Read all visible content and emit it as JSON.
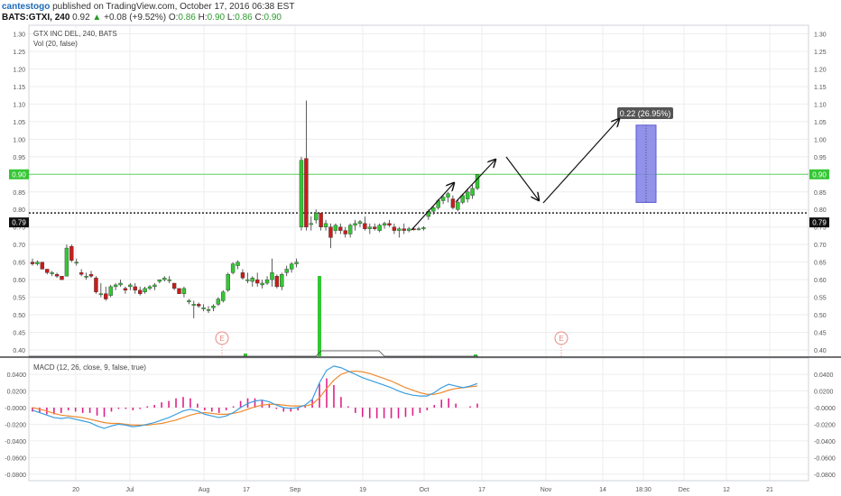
{
  "header": {
    "author": "cantestogo",
    "published_text": "published on TradingView.com, October 17, 2016 06:38 EST",
    "symbol": "BATS:GTXI, 240",
    "last": "0.92",
    "change_arrow": "▲",
    "change": "+0.08 (+9.52%)",
    "o_label": "O:",
    "o_value": "0.86",
    "h_label": "H:",
    "h_value": "0.90",
    "l_label": "L:",
    "l_value": "0.86",
    "c_label": "C:",
    "c_value": "0.90"
  },
  "colors": {
    "up": "#34c734",
    "down": "#c91c1c",
    "grid": "#eeeeee",
    "macd_line": "#3a9ee0",
    "signal_line": "#f08a2e",
    "histogram": "#e0218a",
    "green_level": "#5fd35f",
    "target_box": "#7f7fe8"
  },
  "chart_data": [
    {
      "type": "candlestick",
      "title": "GTX INC DEL, 240, BATS",
      "subtitle": "Vol (20, false)",
      "ylim": [
        0.36,
        1.32
      ],
      "y_ticks": [
        "1.30",
        "1.25",
        "1.20",
        "1.15",
        "1.10",
        "1.05",
        "1.00",
        "0.95",
        "0.90",
        "0.85",
        "0.80",
        "0.75",
        "0.70",
        "0.65",
        "0.60",
        "0.55",
        "0.50",
        "0.45",
        "0.40"
      ],
      "x_ticks": [
        "20",
        "Jul",
        "Aug",
        "17",
        "Sep",
        "19",
        "Oct",
        "17",
        "Nov",
        "14",
        "18:30",
        "Dec",
        "12",
        "21"
      ],
      "current_price_label": "0.90",
      "dotted_level_label": "0.79",
      "green_level": 0.9,
      "dotted_level": 0.79,
      "earnings_marker": "E",
      "annotation": "0.22 (26.95%)",
      "target_from": 0.82,
      "target_to": 1.04,
      "candles": [
        [
          0.65,
          0.66,
          0.64,
          0.645
        ],
        [
          0.645,
          0.655,
          0.64,
          0.65
        ],
        [
          0.65,
          0.65,
          0.63,
          0.63
        ],
        [
          0.63,
          0.63,
          0.615,
          0.62
        ],
        [
          0.62,
          0.625,
          0.61,
          0.62
        ],
        [
          0.615,
          0.62,
          0.605,
          0.61
        ],
        [
          0.61,
          0.61,
          0.6,
          0.6
        ],
        [
          0.61,
          0.7,
          0.61,
          0.69
        ],
        [
          0.695,
          0.7,
          0.65,
          0.655
        ],
        [
          0.65,
          0.66,
          0.64,
          0.65
        ],
        [
          0.62,
          0.63,
          0.61,
          0.615
        ],
        [
          0.61,
          0.62,
          0.6,
          0.61
        ],
        [
          0.615,
          0.625,
          0.605,
          0.61
        ],
        [
          0.605,
          0.61,
          0.56,
          0.565
        ],
        [
          0.56,
          0.59,
          0.55,
          0.56
        ],
        [
          0.56,
          0.58,
          0.54,
          0.545
        ],
        [
          0.555,
          0.585,
          0.55,
          0.58
        ],
        [
          0.58,
          0.59,
          0.57,
          0.585
        ],
        [
          0.585,
          0.6,
          0.58,
          0.59
        ],
        [
          0.575,
          0.58,
          0.56,
          0.57
        ],
        [
          0.58,
          0.59,
          0.57,
          0.585
        ],
        [
          0.58,
          0.59,
          0.56,
          0.57
        ],
        [
          0.57,
          0.58,
          0.555,
          0.56
        ],
        [
          0.565,
          0.58,
          0.56,
          0.575
        ],
        [
          0.575,
          0.585,
          0.57,
          0.58
        ],
        [
          0.58,
          0.59,
          0.57,
          0.585
        ],
        [
          0.595,
          0.6,
          0.59,
          0.6
        ],
        [
          0.6,
          0.61,
          0.595,
          0.605
        ],
        [
          0.6,
          0.61,
          0.59,
          0.6
        ],
        [
          0.59,
          0.59,
          0.57,
          0.575
        ],
        [
          0.575,
          0.575,
          0.56,
          0.56
        ],
        [
          0.56,
          0.58,
          0.55,
          0.575
        ],
        [
          0.54,
          0.545,
          0.53,
          0.54
        ],
        [
          0.53,
          0.54,
          0.49,
          0.53
        ],
        [
          0.53,
          0.535,
          0.52,
          0.525
        ],
        [
          0.52,
          0.53,
          0.51,
          0.52
        ],
        [
          0.515,
          0.525,
          0.505,
          0.515
        ],
        [
          0.52,
          0.53,
          0.51,
          0.525
        ],
        [
          0.53,
          0.55,
          0.525,
          0.545
        ],
        [
          0.54,
          0.57,
          0.535,
          0.565
        ],
        [
          0.57,
          0.62,
          0.565,
          0.615
        ],
        [
          0.62,
          0.65,
          0.615,
          0.645
        ],
        [
          0.64,
          0.655,
          0.63,
          0.65
        ],
        [
          0.62,
          0.63,
          0.6,
          0.605
        ],
        [
          0.6,
          0.62,
          0.59,
          0.6
        ],
        [
          0.595,
          0.61,
          0.58,
          0.605
        ],
        [
          0.6,
          0.62,
          0.58,
          0.59
        ],
        [
          0.585,
          0.6,
          0.575,
          0.59
        ],
        [
          0.59,
          0.61,
          0.585,
          0.6
        ],
        [
          0.6,
          0.66,
          0.58,
          0.62
        ],
        [
          0.61,
          0.615,
          0.575,
          0.58
        ],
        [
          0.58,
          0.62,
          0.57,
          0.615
        ],
        [
          0.62,
          0.64,
          0.61,
          0.63
        ],
        [
          0.63,
          0.65,
          0.62,
          0.645
        ],
        [
          0.645,
          0.66,
          0.635,
          0.65
        ],
        [
          0.75,
          0.95,
          0.74,
          0.94
        ],
        [
          0.945,
          1.11,
          0.74,
          0.75
        ],
        [
          0.76,
          0.78,
          0.74,
          0.76
        ],
        [
          0.77,
          0.8,
          0.76,
          0.79
        ],
        [
          0.79,
          0.79,
          0.74,
          0.75
        ],
        [
          0.75,
          0.77,
          0.74,
          0.76
        ],
        [
          0.75,
          0.76,
          0.69,
          0.72
        ],
        [
          0.74,
          0.76,
          0.73,
          0.755
        ],
        [
          0.75,
          0.76,
          0.73,
          0.74
        ],
        [
          0.74,
          0.75,
          0.72,
          0.73
        ],
        [
          0.73,
          0.76,
          0.72,
          0.755
        ],
        [
          0.755,
          0.77,
          0.74,
          0.76
        ],
        [
          0.76,
          0.77,
          0.75,
          0.765
        ],
        [
          0.76,
          0.78,
          0.74,
          0.745
        ],
        [
          0.745,
          0.76,
          0.73,
          0.75
        ],
        [
          0.75,
          0.76,
          0.74,
          0.745
        ],
        [
          0.74,
          0.76,
          0.735,
          0.755
        ],
        [
          0.755,
          0.765,
          0.745,
          0.76
        ],
        [
          0.76,
          0.77,
          0.75,
          0.755
        ],
        [
          0.75,
          0.76,
          0.73,
          0.74
        ],
        [
          0.74,
          0.75,
          0.72,
          0.745
        ],
        [
          0.745,
          0.76,
          0.73,
          0.74
        ],
        [
          0.74,
          0.75,
          0.735,
          0.745
        ],
        [
          0.745,
          0.75,
          0.74,
          0.742
        ],
        [
          0.742,
          0.75,
          0.74,
          0.745
        ],
        [
          0.745,
          0.752,
          0.74,
          0.748
        ],
        [
          0.78,
          0.8,
          0.77,
          0.795
        ],
        [
          0.795,
          0.81,
          0.785,
          0.805
        ],
        [
          0.805,
          0.83,
          0.8,
          0.825
        ],
        [
          0.825,
          0.84,
          0.815,
          0.835
        ],
        [
          0.835,
          0.85,
          0.82,
          0.845
        ],
        [
          0.83,
          0.84,
          0.8,
          0.805
        ],
        [
          0.8,
          0.83,
          0.795,
          0.82
        ],
        [
          0.82,
          0.845,
          0.815,
          0.84
        ],
        [
          0.83,
          0.86,
          0.82,
          0.85
        ],
        [
          0.84,
          0.87,
          0.83,
          0.86
        ],
        [
          0.86,
          0.9,
          0.855,
          0.9
        ]
      ]
    },
    {
      "type": "line",
      "title": "MACD (12, 26, close, 9, false, true)",
      "ylim": [
        -0.09,
        0.06
      ],
      "y_ticks": [
        "0.0400",
        "0.0200",
        "-0.0000",
        "-0.0200",
        "-0.0400",
        "-0.0600",
        "-0.0800"
      ],
      "series": [
        {
          "values": [
            -0.003,
            -0.006,
            -0.009,
            -0.012,
            -0.013,
            -0.012,
            -0.014,
            -0.016,
            -0.018,
            -0.022,
            -0.025,
            -0.022,
            -0.02,
            -0.021,
            -0.023,
            -0.022,
            -0.02,
            -0.018,
            -0.015,
            -0.012,
            -0.008,
            -0.004,
            -0.002,
            -0.004,
            -0.008,
            -0.01,
            -0.012,
            -0.01,
            -0.006,
            0.0,
            0.005,
            0.008,
            0.009,
            0.007,
            0.003,
            0.0,
            -0.001,
            0.0,
            0.003,
            0.01,
            0.03,
            0.045,
            0.05,
            0.048,
            0.044,
            0.04,
            0.036,
            0.033,
            0.03,
            0.027,
            0.024,
            0.02,
            0.017,
            0.015,
            0.014,
            0.014,
            0.018,
            0.024,
            0.028,
            0.026,
            0.024,
            0.026,
            0.029
          ]
        },
        {
          "values": [
            0.0,
            -0.002,
            -0.004,
            -0.007,
            -0.009,
            -0.01,
            -0.011,
            -0.012,
            -0.014,
            -0.016,
            -0.018,
            -0.019,
            -0.019,
            -0.02,
            -0.021,
            -0.021,
            -0.021,
            -0.02,
            -0.019,
            -0.017,
            -0.015,
            -0.012,
            -0.009,
            -0.007,
            -0.006,
            -0.007,
            -0.008,
            -0.008,
            -0.007,
            -0.005,
            -0.002,
            0.001,
            0.003,
            0.004,
            0.004,
            0.003,
            0.002,
            0.002,
            0.002,
            0.004,
            0.012,
            0.023,
            0.033,
            0.04,
            0.043,
            0.044,
            0.043,
            0.041,
            0.038,
            0.035,
            0.032,
            0.028,
            0.024,
            0.021,
            0.018,
            0.016,
            0.016,
            0.018,
            0.021,
            0.023,
            0.024,
            0.025,
            0.026
          ]
        }
      ]
    }
  ]
}
